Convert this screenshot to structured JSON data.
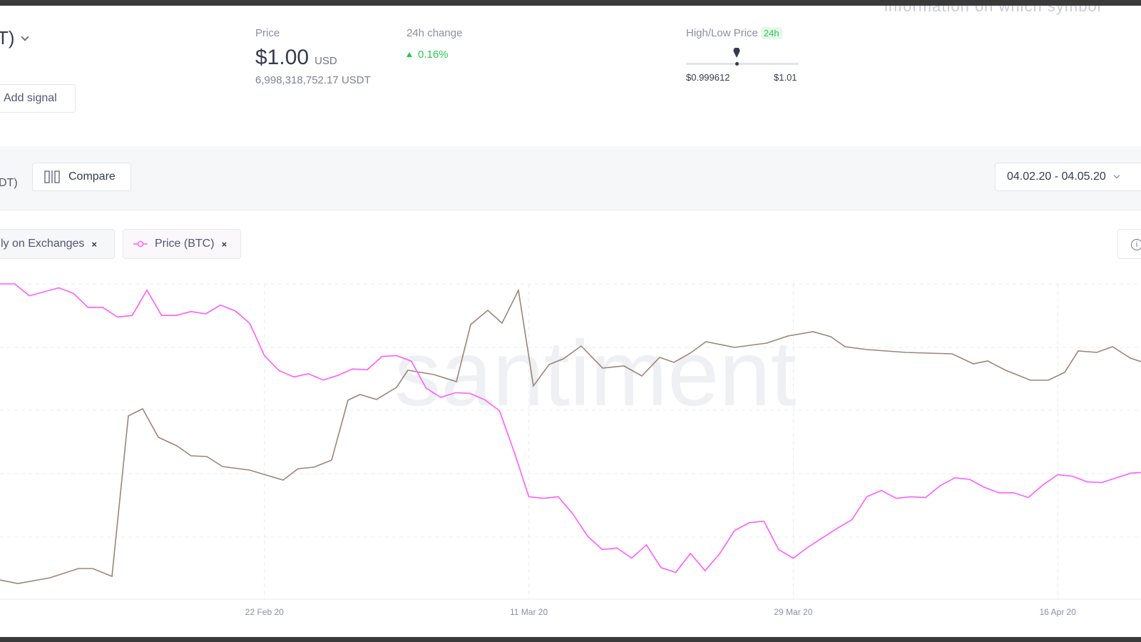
{
  "header": {
    "title_fragment": "T)",
    "price_label": "Price",
    "price_value": "$1.00",
    "price_unit": "USD",
    "supply": "6,998,318,752.17 USDT",
    "change_label": "24h change",
    "change_value": "0.16%",
    "high_low_label": "High/Low Price",
    "high_low_period": "24h",
    "low_value": "$0.999612",
    "high_value": "$1.01",
    "add_signal_label": "Add signal",
    "top_right_fragment": "information on which symbol"
  },
  "toolbar": {
    "ticker_fragment": "DT)",
    "compare_label": "Compare",
    "date_range": "04.02.20 - 04.05.20"
  },
  "metrics": [
    {
      "label": "ly on Exchanges",
      "remove": "×"
    },
    {
      "label": "Price (BTC)",
      "remove": "×"
    }
  ],
  "watermark": "santiment",
  "colors": {
    "price_btc": "#ff5cff",
    "supply_on_exchanges": "#9b8578",
    "positive": "#26c953",
    "grid": "#e9ebef"
  },
  "icons": {
    "compare": "compare-icon",
    "info": "info-icon",
    "chevron": "chevron-down-icon",
    "price_btc": "line-series-icon"
  },
  "chart_data": {
    "type": "line",
    "x_labels": [
      "22 Feb 20",
      "11 Mar 20",
      "29 Mar 20",
      "16 Apr 20"
    ],
    "x_label_indices": [
      18,
      36,
      54,
      72
    ],
    "series": [
      {
        "name": "Price (BTC)",
        "color": "#ff5cff",
        "values": [
          100,
          100,
          98.5,
          99,
          99.5,
          98.8,
          97,
          97,
          95.8,
          96,
          99.2,
          96,
          96,
          96.5,
          96.2,
          97.3,
          96.6,
          95,
          90.9,
          89,
          88.2,
          88.6,
          87.8,
          88.4,
          89.2,
          89.1,
          90.8,
          90.9,
          90.2,
          86.8,
          85.6,
          86.2,
          86.1,
          85.3,
          83.9,
          78.7,
          73,
          72.8,
          73,
          70.8,
          68,
          66.3,
          66.5,
          65.2,
          66.9,
          64,
          63.4,
          65.8,
          63.6,
          65.8,
          68.7,
          69.7,
          69.9,
          66.3,
          65.2,
          66.6,
          67.8,
          69,
          70.1,
          73,
          73.8,
          72.8,
          73,
          72.9,
          74.4,
          75.4,
          75.2,
          74.2,
          73.5,
          73.5,
          72.9,
          74.5,
          75.8,
          75.6,
          74.9,
          74.8,
          75.4,
          76,
          76.1,
          75.7,
          76.3,
          77.3
        ],
        "values_tail": "continues to the right edge of the view"
      },
      {
        "name": "Supply on Exchanges",
        "color": "#9b8578"
      }
    ],
    "grid": true,
    "legend": "top-left"
  }
}
